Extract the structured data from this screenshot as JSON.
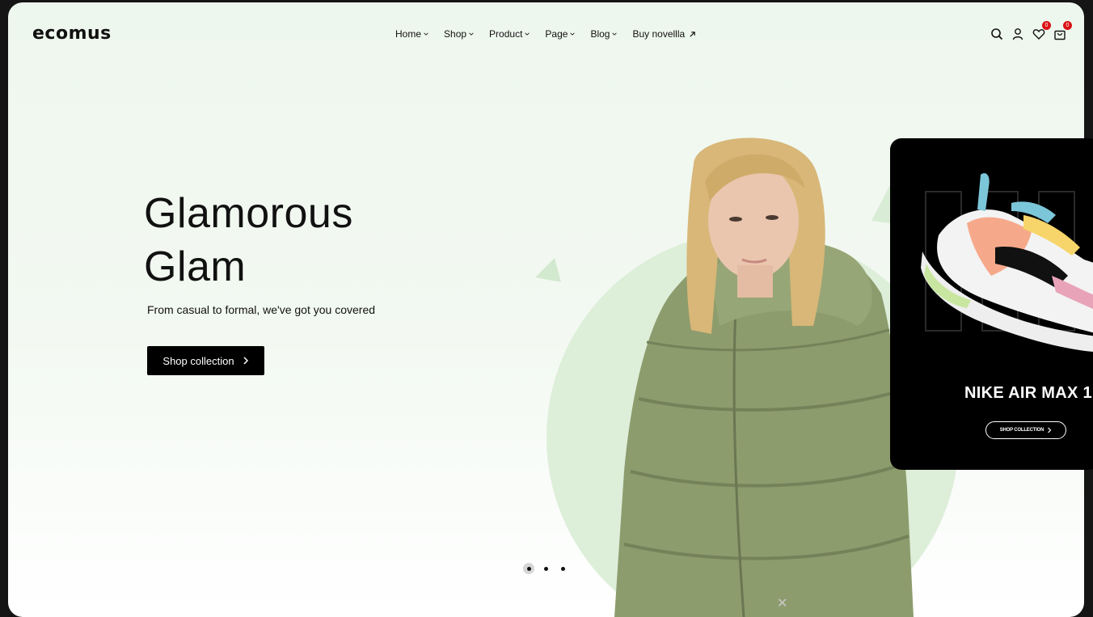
{
  "header": {
    "logo": "ecomus",
    "nav": [
      {
        "label": "Home"
      },
      {
        "label": "Shop"
      },
      {
        "label": "Product"
      },
      {
        "label": "Page"
      },
      {
        "label": "Blog"
      },
      {
        "label": "Buy novellla"
      }
    ],
    "wishlist_count": "0",
    "cart_count": "0"
  },
  "hero": {
    "title_line1": "Glamorous",
    "title_line2": "Glam",
    "subtitle": "From casual to formal, we've got you covered",
    "cta_label": "Shop collection",
    "slides_total": 3,
    "active_slide": 1
  },
  "popup": {
    "title": "NIKE AIR MAX 1",
    "cta_label": "SHOP COLLECTION",
    "close_glyph": "✕"
  },
  "colors": {
    "hero_bg": "#eef7ee",
    "accent_circle": "#ddeed9",
    "badge": "#db1215",
    "button": "#000000"
  }
}
